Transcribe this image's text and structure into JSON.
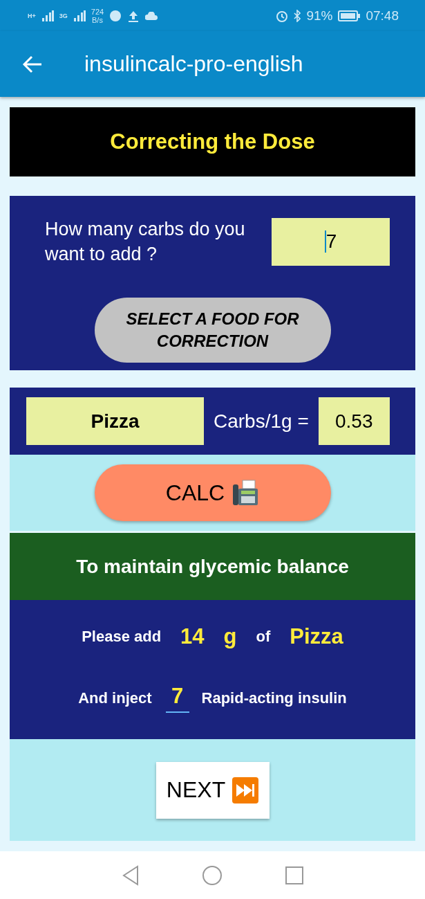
{
  "status_bar": {
    "network_1": "H+",
    "network_2": "3G",
    "speed_value": "724",
    "speed_unit": "B/s",
    "battery": "91%",
    "time": "07:48"
  },
  "app_bar": {
    "title": "insulincalc-pro-english"
  },
  "header": {
    "title": "Correcting the Dose"
  },
  "question": {
    "label": "How many carbs do you want to add ?",
    "value": "7",
    "focused": true
  },
  "select_button": {
    "label": "SELECT A FOOD FOR CORRECTION"
  },
  "food": {
    "name": "Pizza",
    "ratio_label": "Carbs/1g =",
    "ratio_value": "0.53"
  },
  "calc_button": {
    "label": "CALC"
  },
  "result_title": "To maintain glycemic balance",
  "result_line_1": {
    "prefix": "Please add",
    "amount": "14",
    "unit": "g",
    "of": "of",
    "food": "Pizza"
  },
  "result_line_2": {
    "prefix": "And inject",
    "dose": "7",
    "suffix": "Rapid-acting insulin"
  },
  "next_button": {
    "label": "NEXT"
  }
}
